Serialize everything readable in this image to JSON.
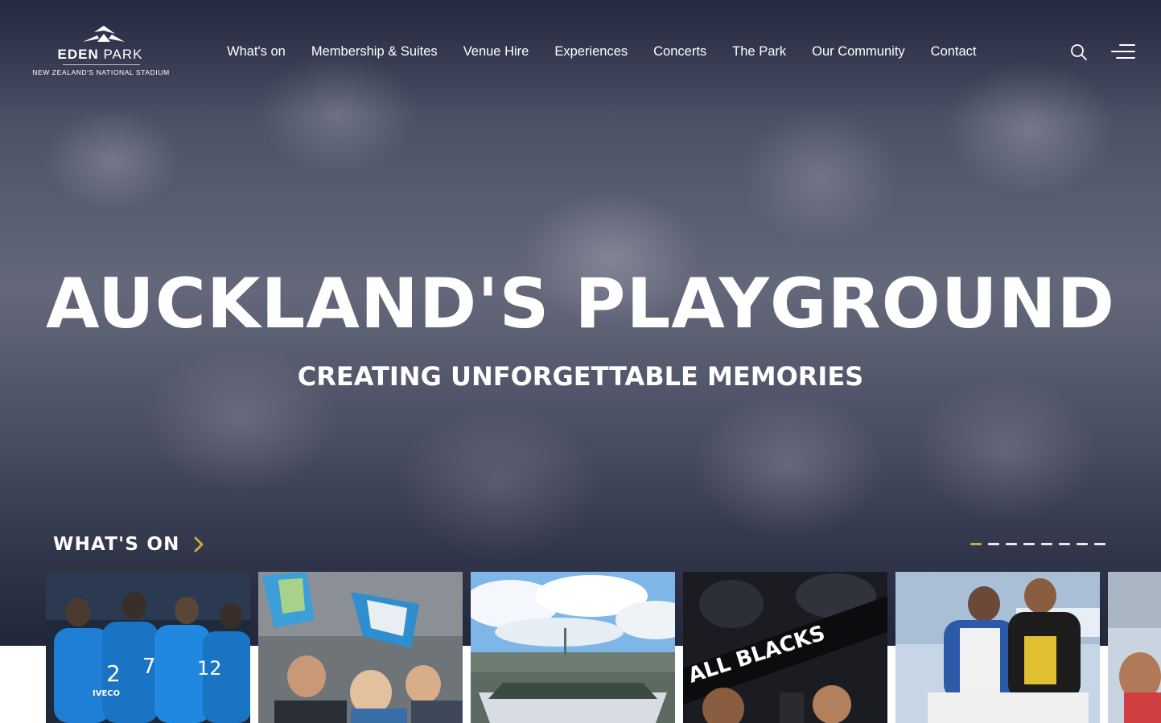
{
  "brand": {
    "name_bold": "EDEN",
    "name_light": "PARK",
    "tagline": "NEW ZEALAND'S NATIONAL STADIUM"
  },
  "nav": {
    "items": [
      {
        "label": "What's on"
      },
      {
        "label": "Membership & Suites"
      },
      {
        "label": "Venue Hire"
      },
      {
        "label": "Experiences"
      },
      {
        "label": "Concerts"
      },
      {
        "label": "The Park"
      },
      {
        "label": "Our Community"
      },
      {
        "label": "Contact"
      }
    ],
    "search_icon": "search-icon",
    "menu_icon": "hamburger-menu-icon"
  },
  "hero": {
    "headline": "AUCKLAND'S PLAYGROUND",
    "subheadline": "CREATING UNFORGETTABLE MEMORIES"
  },
  "whats_on": {
    "label": "WHAT'S ON",
    "chevron_icon": "chevron-right-icon",
    "chevron_color": "#c8a94a",
    "slide_count": 8,
    "active_slide": 1
  },
  "cards": [
    {
      "name": "blues-team-huddle-card",
      "scene": "rugby team huddle in blue jerseys",
      "jersey_numbers": [
        "2",
        "7",
        "12"
      ],
      "sponsor": "IVECO"
    },
    {
      "name": "fans-with-flags-card",
      "scene": "fans waving blue and white flags"
    },
    {
      "name": "stadium-aerial-card",
      "scene": "aerial view of the stadium under a cloudy sky"
    },
    {
      "name": "all-blacks-fans-card",
      "scene": "fans holding an All Blacks scarf",
      "scarf_text": "ALL BLACKS"
    },
    {
      "name": "rugby-tackle-card",
      "scene": "rugby players in a tackle"
    },
    {
      "name": "partial-card",
      "scene": "partially visible next event"
    }
  ],
  "colors": {
    "accent_gold": "#c8a94a",
    "hero_overlay": "#2f3347",
    "text": "#ffffff"
  }
}
